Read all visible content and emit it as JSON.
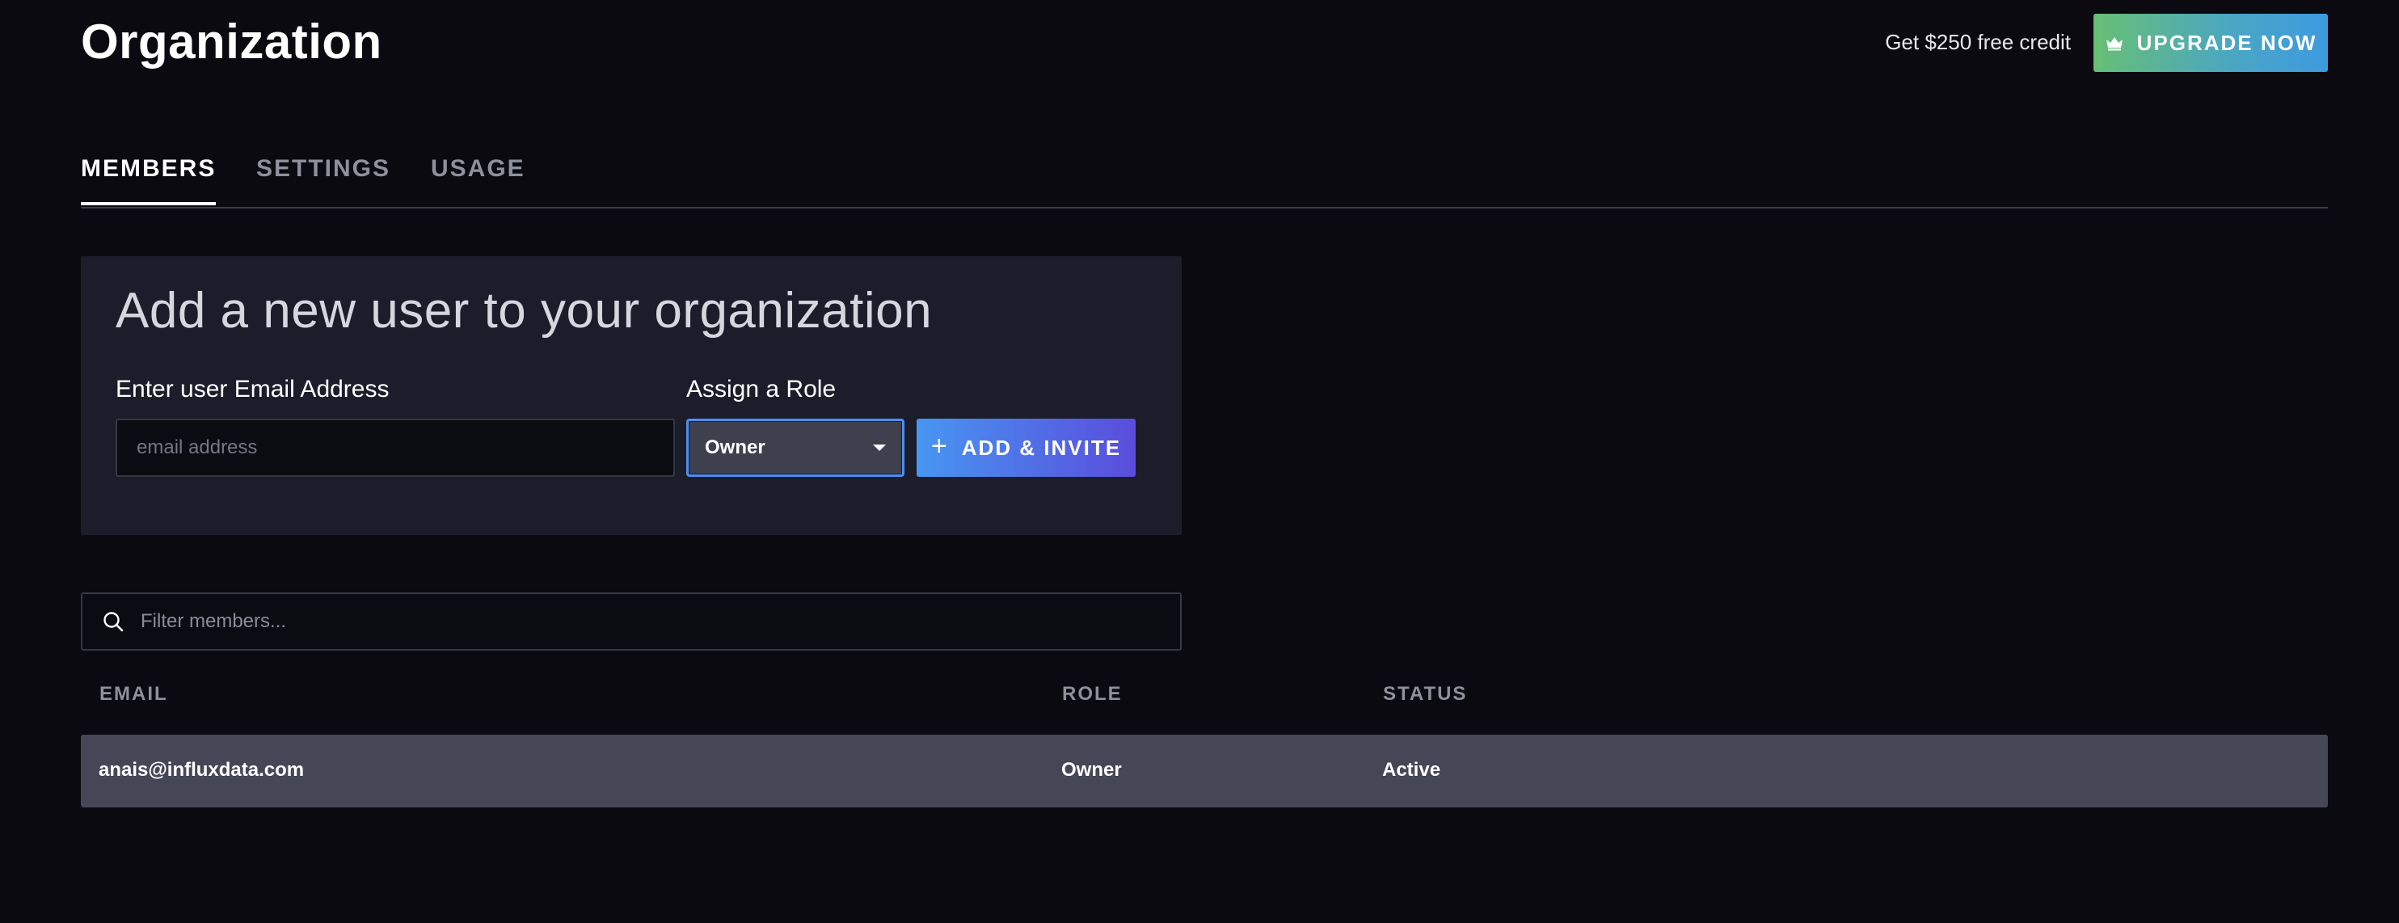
{
  "header": {
    "title": "Organization",
    "credit_text": "Get $250 free credit",
    "upgrade_label": "UPGRADE NOW",
    "upgrade_icon": "crown-icon"
  },
  "tabs": [
    {
      "label": "MEMBERS",
      "active": true
    },
    {
      "label": "SETTINGS",
      "active": false
    },
    {
      "label": "USAGE",
      "active": false
    }
  ],
  "add_user": {
    "title": "Add a new user to your organization",
    "email_label": "Enter user Email Address",
    "email_placeholder": "email address",
    "email_value": "",
    "role_label": "Assign a Role",
    "role_value": "Owner",
    "add_label": "ADD & INVITE",
    "add_icon": "plus-icon"
  },
  "filter": {
    "placeholder": "Filter members...",
    "value": "",
    "icon": "search-icon"
  },
  "table": {
    "columns": [
      "EMAIL",
      "ROLE",
      "STATUS"
    ],
    "rows": [
      {
        "email": "anais@influxdata.com",
        "role": "Owner",
        "status": "Active"
      }
    ]
  },
  "colors": {
    "background": "#0a0a10",
    "panel": "#1c1d2a",
    "row": "#454656",
    "upgrade_gradient": [
      "#67bf74",
      "#3d9ae0"
    ],
    "add_gradient": [
      "#4896f2",
      "#5a4cdc"
    ],
    "select_focus": "#4c8ff2"
  }
}
